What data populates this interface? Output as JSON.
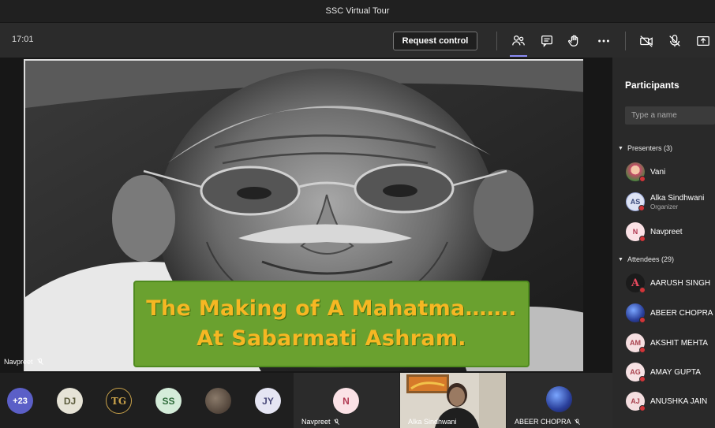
{
  "window": {
    "title": "SSC Virtual Tour"
  },
  "toolbar": {
    "time": "17:01",
    "request_control_label": "Request control",
    "icons": [
      "people-icon",
      "chat-icon",
      "raise-hand-icon",
      "more-options-icon",
      "camera-off-icon",
      "mic-off-icon",
      "share-tray-icon"
    ]
  },
  "stage": {
    "slide_text_line1": "The Making of A Mahatma…….",
    "slide_text_line2": "At Sabarmati Ashram.",
    "speaker_name": "Navpreet"
  },
  "strip": {
    "overflow_count": "+23",
    "avatars": [
      {
        "initials": "DJ",
        "bg": "#e6e3d6",
        "fg": "#5a5a3a"
      },
      {
        "initials": "TG",
        "bg": "#1a1a1a",
        "fg": "#c9a24a"
      },
      {
        "initials": "SS",
        "bg": "#d4ecd9",
        "fg": "#2e6b3a"
      },
      {
        "initials": "",
        "bg": "#5a4a3a",
        "fg": "#fff"
      },
      {
        "initials": "JY",
        "bg": "#e5e5f3",
        "fg": "#4a4a7a"
      }
    ],
    "tiles": [
      {
        "initials": "N",
        "name": "Navpreet"
      },
      {
        "name": "Alka Sindhwani"
      },
      {
        "name": "ABEER CHOPRA"
      }
    ]
  },
  "panel": {
    "title": "Participants",
    "search_placeholder": "Type a name",
    "presenters_label": "Presenters (3)",
    "attendees_label": "Attendees (29)",
    "presenters": [
      {
        "name": "Vani",
        "initials": "",
        "bg": "#c94b6a",
        "fg": "#fff"
      },
      {
        "name": "Alka Sindhwani",
        "sub": "Organizer",
        "initials": "AS",
        "bg": "#dde3f4",
        "fg": "#3b4a7a"
      },
      {
        "name": "Navpreet",
        "initials": "N",
        "bg": "#fbe2e6",
        "fg": "#b13a52"
      }
    ],
    "attendees": [
      {
        "name": "AARUSH SINGH",
        "initials": "A",
        "bg": "#1b1b1b",
        "fg": "#e84a5f"
      },
      {
        "name": "ABEER CHOPRA",
        "initials": "",
        "bg": "#3a5ba8",
        "fg": "#fff"
      },
      {
        "name": "AKSHIT MEHTA",
        "initials": "AM",
        "bg": "#f6dfe1",
        "fg": "#a8424e"
      },
      {
        "name": "AMAY GUPTA",
        "initials": "AG",
        "bg": "#f7e2e4",
        "fg": "#a8424e"
      },
      {
        "name": "ANUSHKA JAIN",
        "initials": "AJ",
        "bg": "#f4dee0",
        "fg": "#a8424e"
      }
    ]
  }
}
